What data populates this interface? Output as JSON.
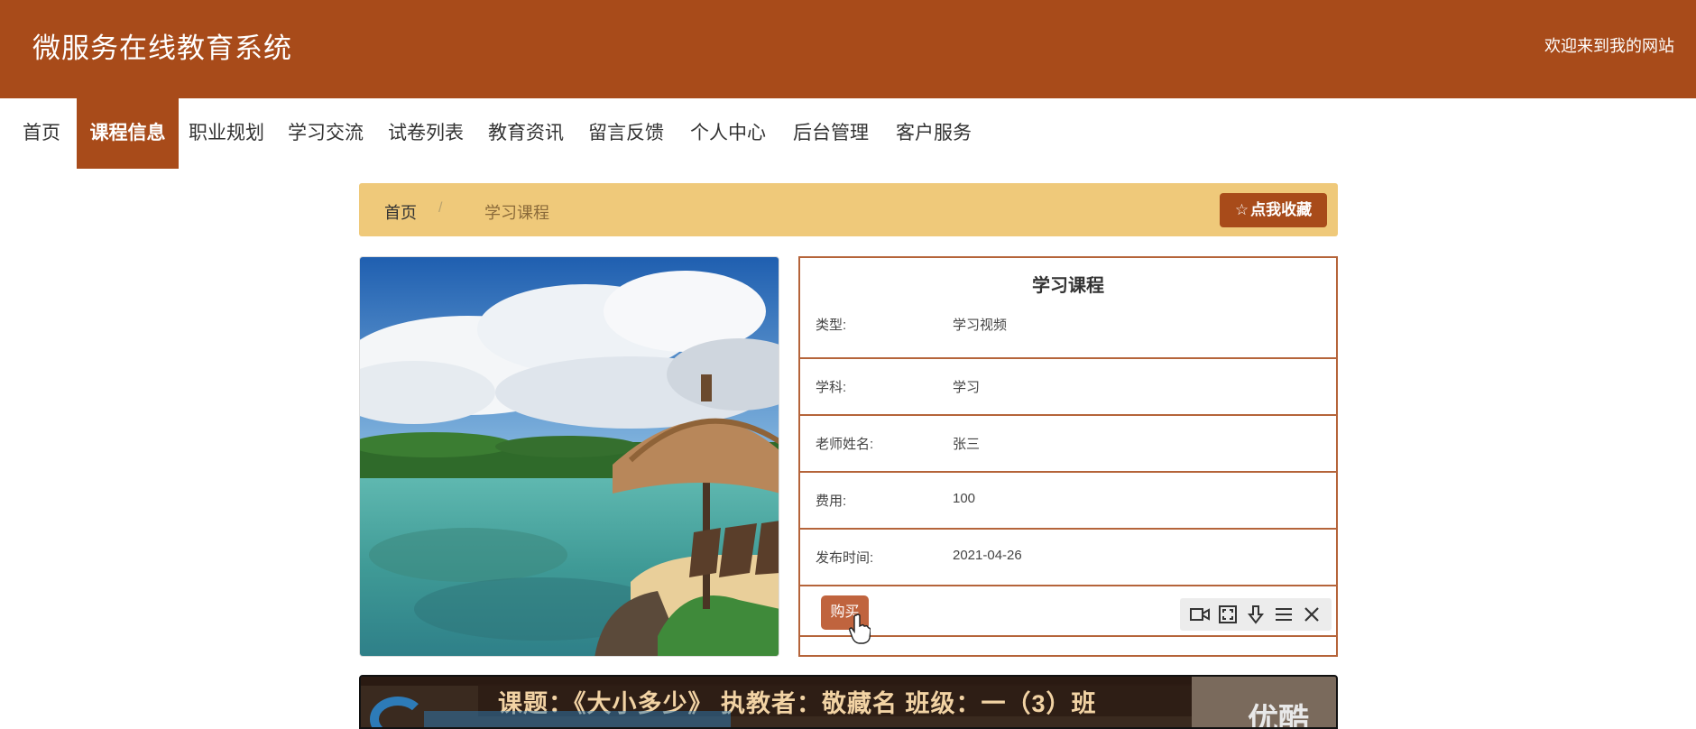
{
  "header": {
    "site_title": "微服务在线教育系统",
    "welcome": "欢迎来到我的网站"
  },
  "nav": {
    "items": [
      {
        "label": "首页",
        "active": false
      },
      {
        "label": "课程信息",
        "active": true
      },
      {
        "label": "职业规划",
        "active": false
      },
      {
        "label": "学习交流",
        "active": false
      },
      {
        "label": "试卷列表",
        "active": false
      },
      {
        "label": "教育资讯",
        "active": false
      },
      {
        "label": "留言反馈",
        "active": false
      },
      {
        "label": "个人中心",
        "active": false
      },
      {
        "label": "后台管理",
        "active": false
      },
      {
        "label": "客户服务",
        "active": false
      }
    ]
  },
  "breadcrumb": {
    "home": "首页",
    "separator": "/",
    "current": "学习课程"
  },
  "favorite_button": {
    "icon": "star-outline-icon",
    "label": "点我收藏"
  },
  "course": {
    "title": "学习课程",
    "fields": [
      {
        "label": "类型:",
        "value": "学习视频"
      },
      {
        "label": "学科:",
        "value": "学习"
      },
      {
        "label": "老师姓名:",
        "value": "张三"
      },
      {
        "label": "费用:",
        "value": "100"
      },
      {
        "label": "发布时间:",
        "value": "2021-04-26"
      }
    ],
    "buy_label": "购买"
  },
  "video_toolbar": {
    "icons": [
      "video-camera-icon",
      "fullscreen-icon",
      "download-icon",
      "menu-icon",
      "close-icon"
    ]
  },
  "video": {
    "caption": "课题：《大小多少》 执教者：敬藏名 班级：一（3）班",
    "watermark": "优酷"
  },
  "colors": {
    "brand": "#a84b1a",
    "breadcrumb_bg": "#efc97a",
    "border": "#b5643a",
    "buy": "#c0643e"
  }
}
